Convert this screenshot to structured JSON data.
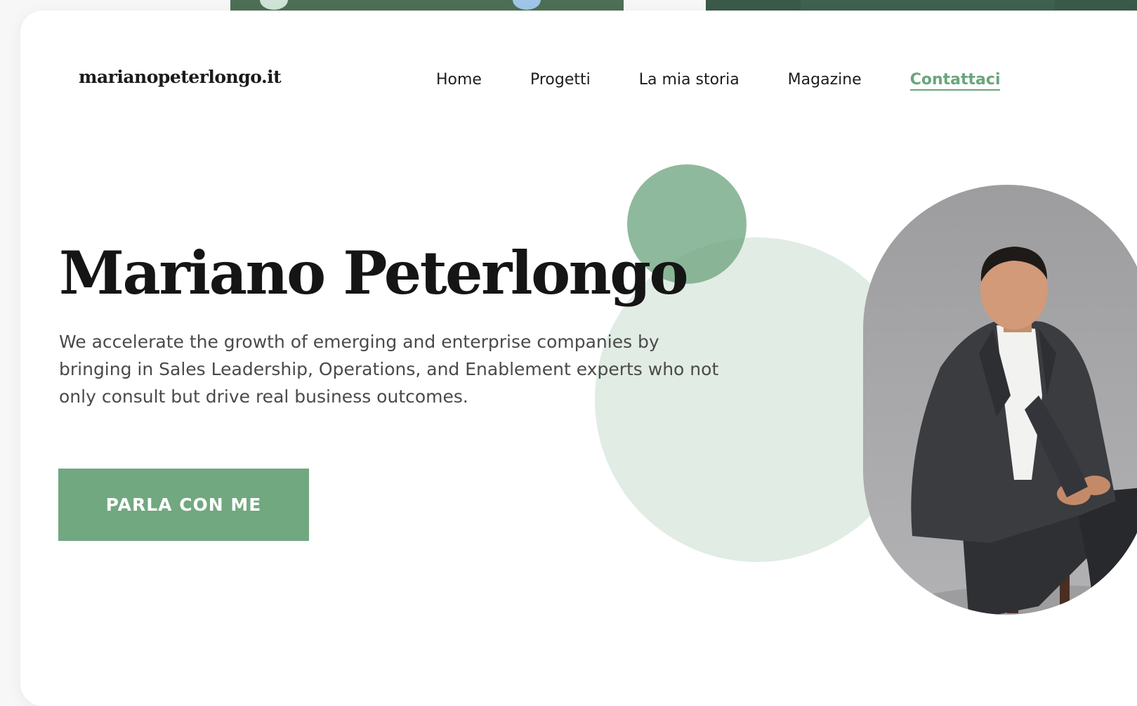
{
  "site": {
    "logo": "marianopeterlongo.it"
  },
  "nav": {
    "items": [
      {
        "label": "Home"
      },
      {
        "label": "Progetti"
      },
      {
        "label": "La mia storia"
      },
      {
        "label": "Magazine"
      },
      {
        "label": "Contattaci"
      }
    ],
    "active_index": 4
  },
  "hero": {
    "title": "Mariano Peterlongo",
    "description": "We accelerate the growth of emerging and enterprise companies by bringing in Sales Leadership, Operations, and Enablement experts who not only consult but drive real business outcomes.",
    "cta_label": "PARLA CON ME"
  },
  "colors": {
    "accent": "#71a880",
    "accent_light": "#e1ece4",
    "text_dark": "#151515",
    "text_body": "#4a4a4a"
  }
}
